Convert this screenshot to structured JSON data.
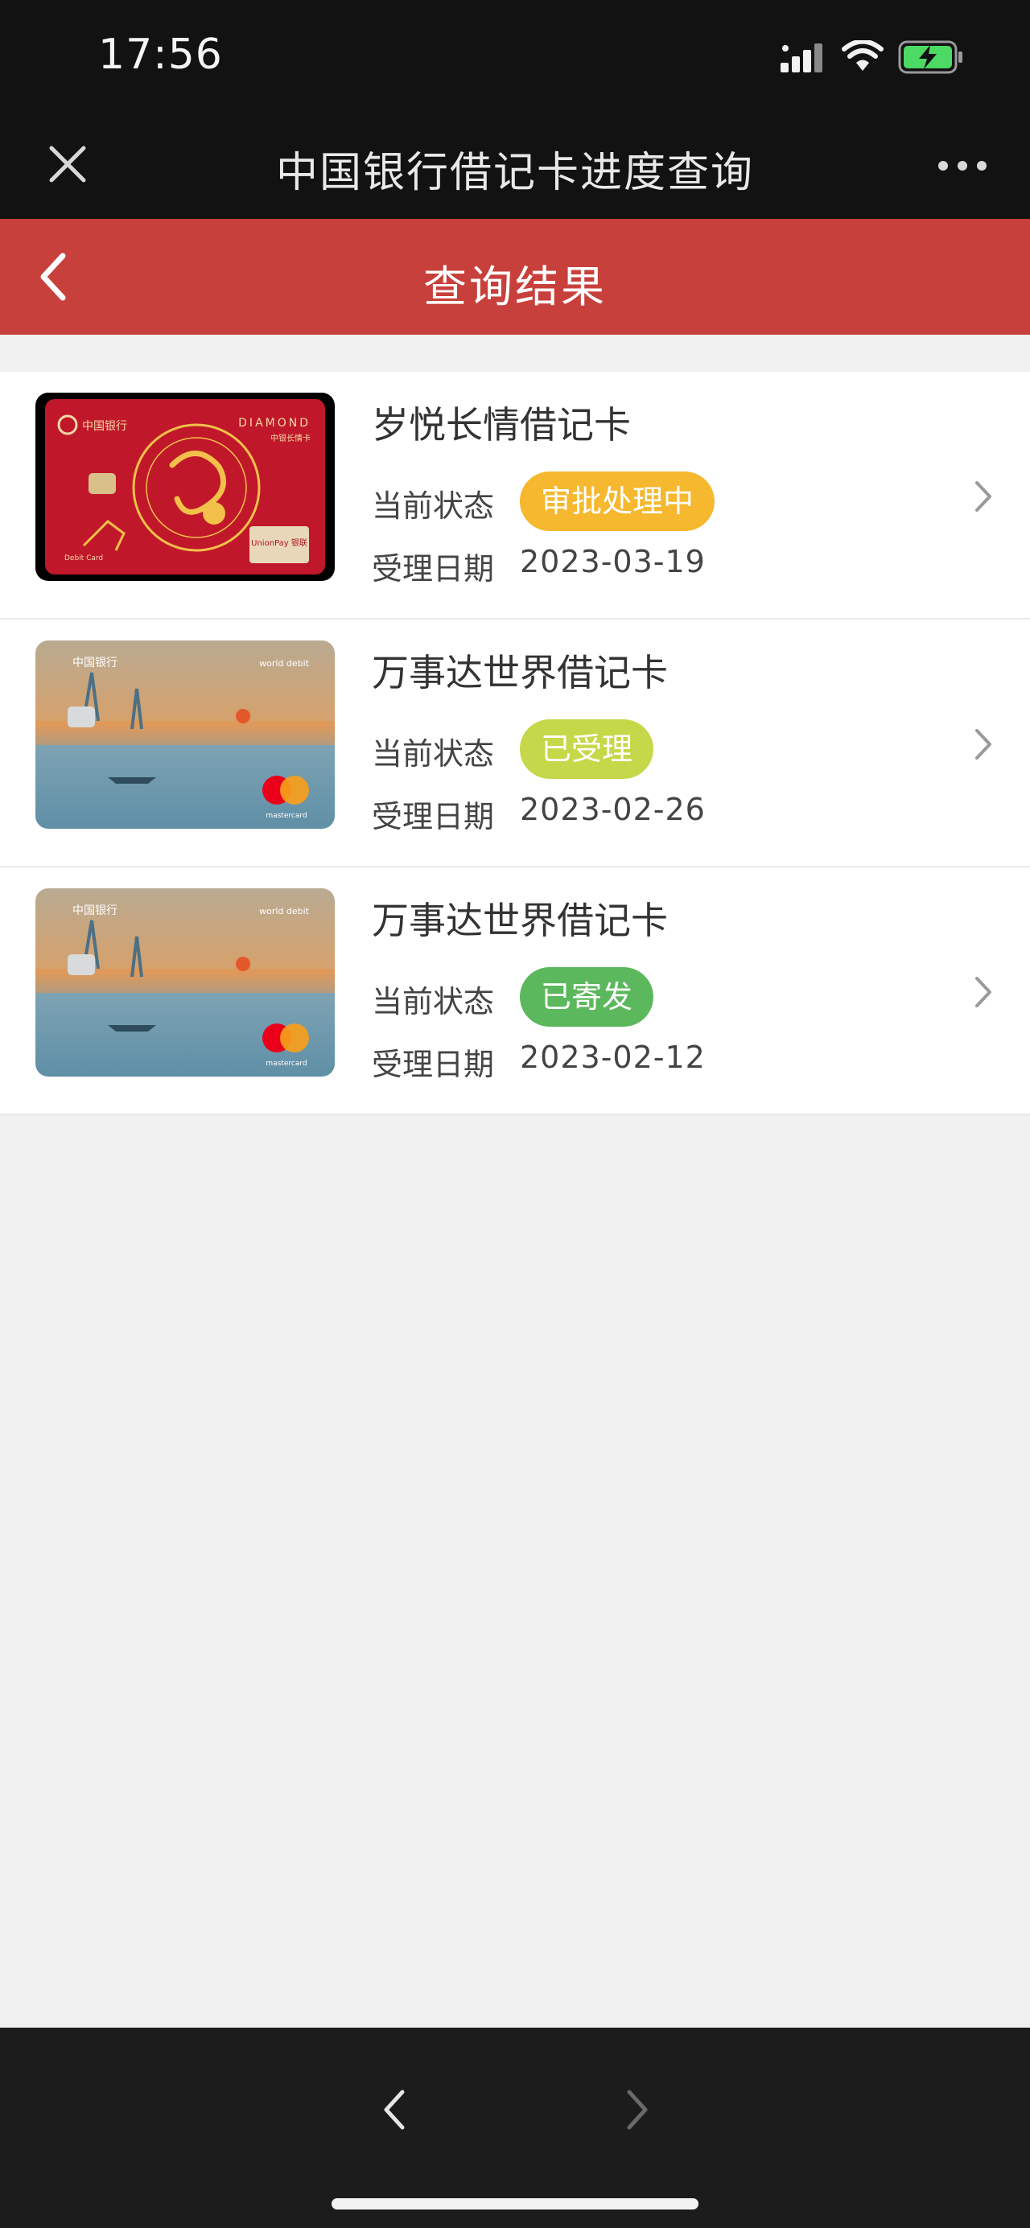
{
  "status_bar": {
    "time": "17:56",
    "signal_icon": "signal-icon",
    "wifi_icon": "wifi-icon",
    "battery_icon": "battery-charging-icon"
  },
  "title_bar": {
    "title": "中国银行借记卡进度查询",
    "close_icon": "close-icon",
    "more_icon": "more-icon"
  },
  "header": {
    "title": "查询结果",
    "back_icon": "chevron-left-icon",
    "color": "#c8403c"
  },
  "items": [
    {
      "name": "岁悦长情借记卡",
      "status_label": "当前状态",
      "status": "审批处理中",
      "status_color": "#f5b82e",
      "date_label": "受理日期",
      "date": "2023-03-19",
      "card_design": "red-rabbit-diamond",
      "card_text": {
        "bank": "中国银行",
        "tier": "DIAMOND",
        "sub": "中银长情卡",
        "network": "UnionPay 银联",
        "type": "Debit Card"
      }
    },
    {
      "name": "万事达世界借记卡",
      "status_label": "当前状态",
      "status": "已受理",
      "status_color": "#c5d84a",
      "date_label": "受理日期",
      "date": "2023-02-26",
      "card_design": "impression-sunrise-mastercard",
      "card_text": {
        "bank": "中国银行",
        "tier": "world debit",
        "network": "mastercard"
      }
    },
    {
      "name": "万事达世界借记卡",
      "status_label": "当前状态",
      "status": "已寄发",
      "status_color": "#5cb85c",
      "date_label": "受理日期",
      "date": "2023-02-12",
      "card_design": "impression-sunrise-mastercard",
      "card_text": {
        "bank": "中国银行",
        "tier": "world debit",
        "network": "mastercard"
      }
    }
  ],
  "bottom_bar": {
    "back_icon": "nav-back-icon",
    "forward_icon": "nav-forward-icon"
  }
}
